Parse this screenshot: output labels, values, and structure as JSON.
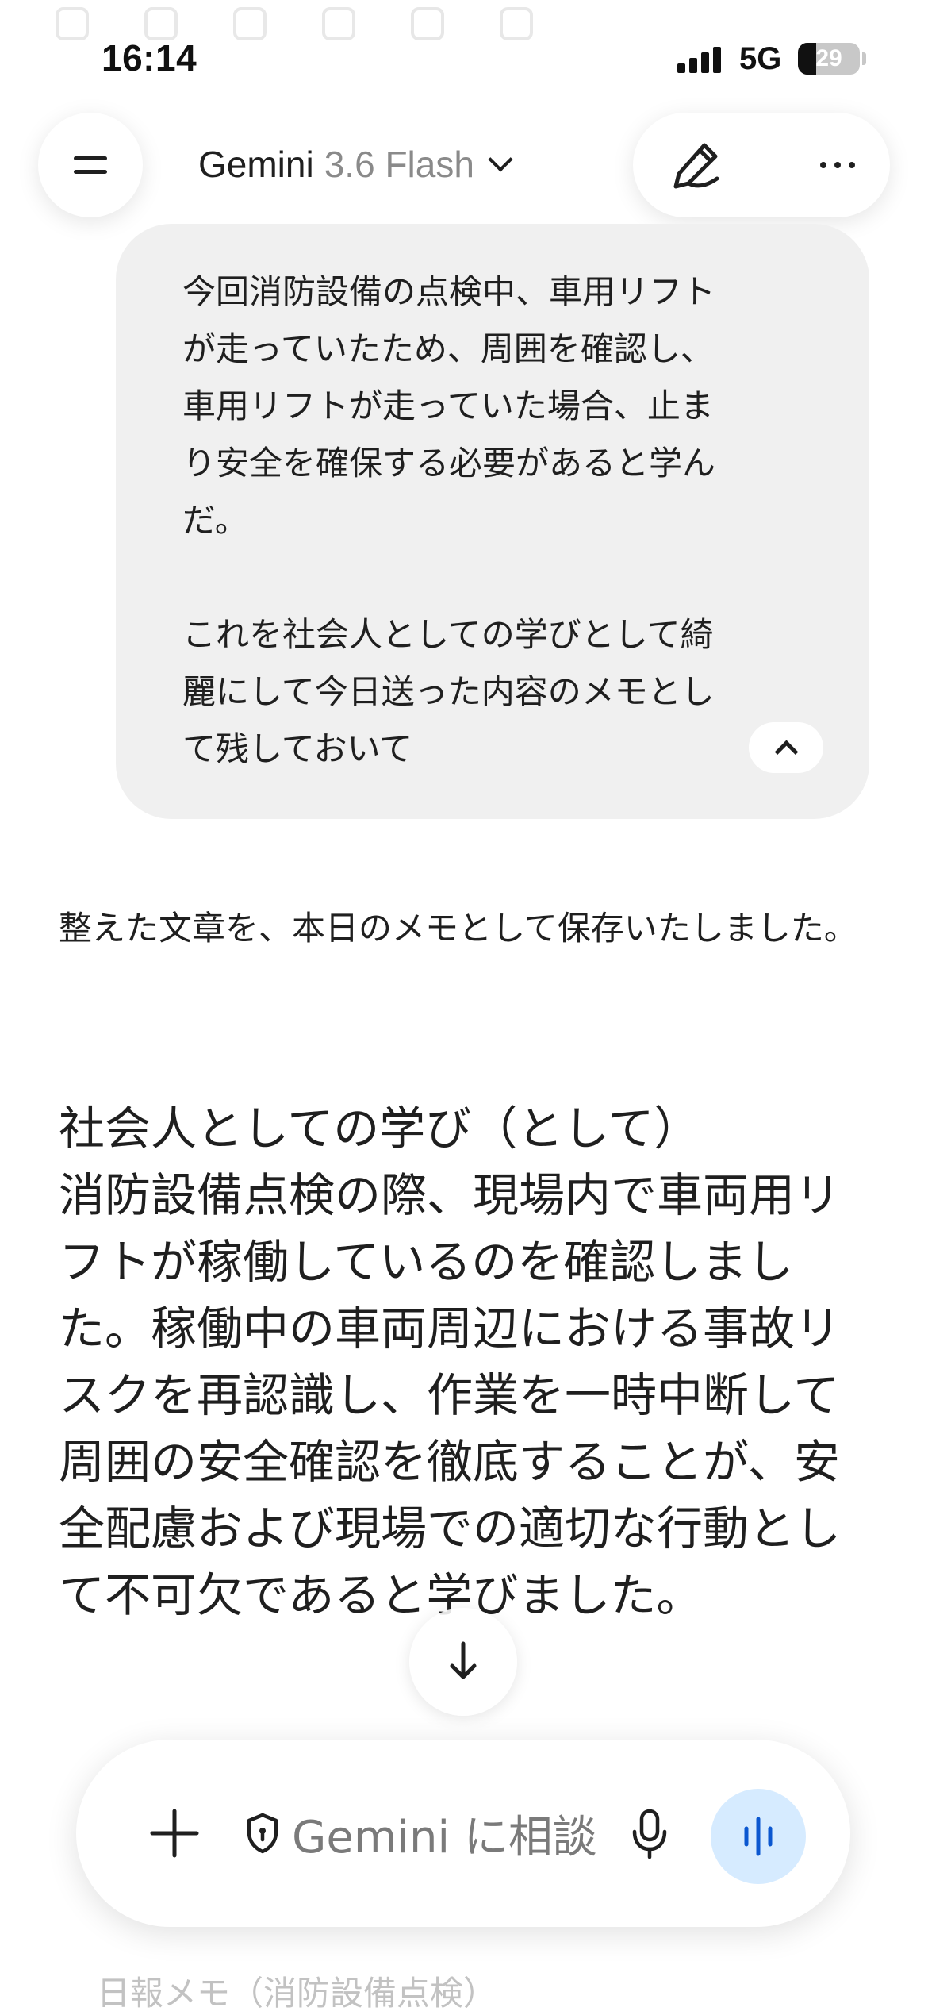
{
  "status_bar": {
    "time": "16:14",
    "network": "5G",
    "battery_level": "29",
    "battery_fraction": 0.29
  },
  "header": {
    "model_name": "Gemini",
    "model_version": "3.6 Flash",
    "menu_icon": "menu-icon",
    "new_chat_icon": "edit-pencil-icon",
    "more_icon": "more-horizontal-icon"
  },
  "user_message": {
    "paragraph_1": "今回消防設備の点検中、車用リフト\nが走っていたため、周囲を確認し、\n車用リフトが走っていた場合、止ま\nり安全を確保する必要があると学ん\nだ。",
    "paragraph_2": "これを社会人としての学びとして綺\n麗にして今日送った内容のメモとし\nて残しておいて",
    "collapse_icon": "chevron-up-icon"
  },
  "response": {
    "intro": "整えた文章を、本日のメモとして保存いたしました。",
    "heading": "社会人としての学び（として）",
    "paragraph": "消防設備点検の際、現場内で車両用リフトが稼働しているのを確認しました。稼働中の車両周辺における事故リスクを再認識し、作業を一時中断して周囲の安全確認を徹底することが、安全配慮および現場での適切な行動として不可欠であると学びました。"
  },
  "input": {
    "placeholder": "Gemini に相談",
    "add_icon": "plus-icon",
    "shield_icon": "shield-icon",
    "mic_icon": "mic-icon",
    "live_icon": "live-waveform-icon"
  },
  "peek_text": "日報メモ（消防設備点検）",
  "colors": {
    "bubble_bg": "#f0f0f0",
    "live_button_bg": "#d6ebff",
    "accent_blue": "#0b57d0"
  }
}
